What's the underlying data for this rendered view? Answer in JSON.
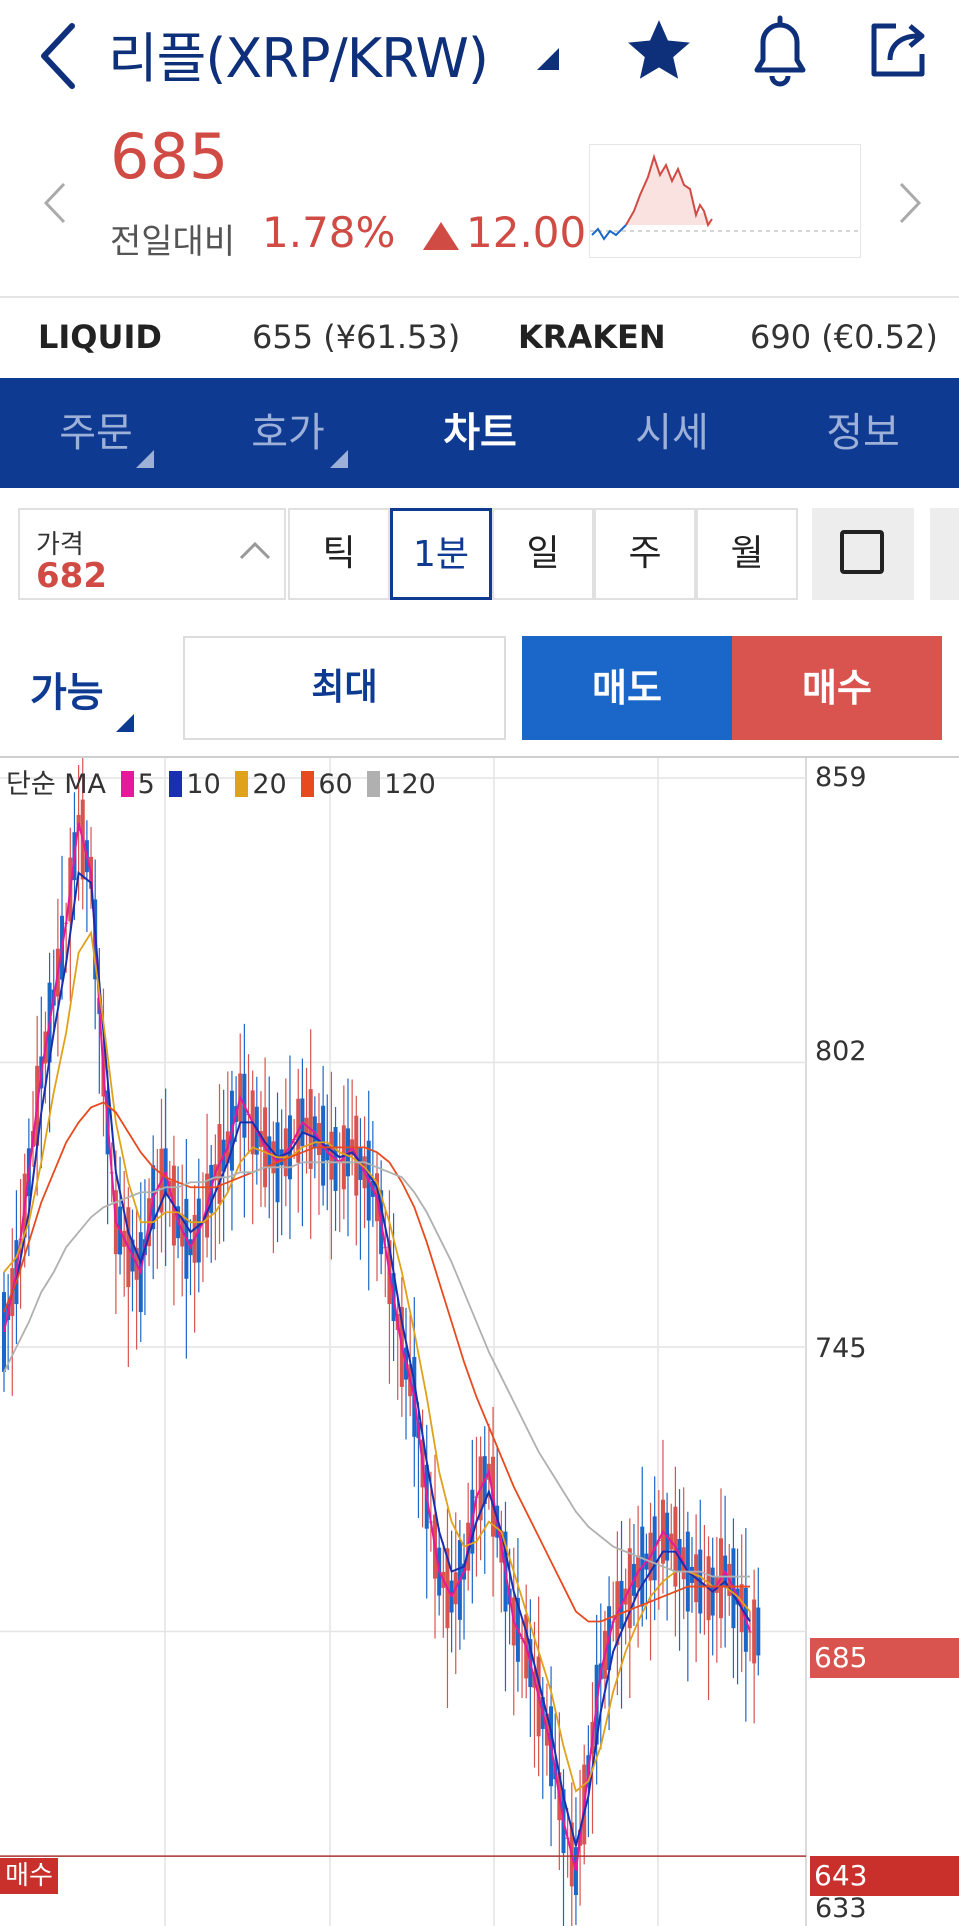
{
  "header": {
    "title": "리플(XRP/KRW)",
    "back_icon": "chevron-left-icon",
    "favorite_icon": "star-icon",
    "alert_icon": "bell-icon",
    "share_icon": "share-icon"
  },
  "summary": {
    "price": "685",
    "change_label": "전일대비",
    "change_pct": "1.78%",
    "change_amount": "12.00",
    "direction": "up",
    "color_up": "#d04b44"
  },
  "exchanges": [
    {
      "name": "LIQUID",
      "value": "655 (¥61.53)"
    },
    {
      "name": "KRAKEN",
      "value": "690 (€0.52)"
    }
  ],
  "tabs": [
    {
      "label": "주문",
      "active": false,
      "has_dropdown": true
    },
    {
      "label": "호가",
      "active": false,
      "has_dropdown": true
    },
    {
      "label": "차트",
      "active": true,
      "has_dropdown": false
    },
    {
      "label": "시세",
      "active": false,
      "has_dropdown": false
    },
    {
      "label": "정보",
      "active": false,
      "has_dropdown": false
    }
  ],
  "price_box": {
    "label": "가격",
    "value": "682"
  },
  "timeframes": [
    {
      "label": "틱",
      "active": false
    },
    {
      "label": "1분",
      "active": true
    },
    {
      "label": "일",
      "active": false
    },
    {
      "label": "주",
      "active": false
    },
    {
      "label": "월",
      "active": false
    }
  ],
  "actions": {
    "available_label": "가능",
    "max_label": "최대",
    "sell_label": "매도",
    "buy_label": "매수",
    "sell_color": "#1b67c9",
    "buy_color": "#d9534f"
  },
  "chart": {
    "legend_prefix": "단순 MA",
    "ma_series": [
      {
        "period": "5",
        "color": "#e5199a"
      },
      {
        "period": "10",
        "color": "#1a2fb0"
      },
      {
        "period": "20",
        "color": "#e0a21a"
      },
      {
        "period": "60",
        "color": "#e84a1f"
      },
      {
        "period": "120",
        "color": "#b0b0b0"
      }
    ],
    "y_labels": [
      "859",
      "802",
      "745"
    ],
    "y_min_label": "633",
    "current_price_tag": "685",
    "buy_line_label": "매수",
    "buy_price_tag": "643"
  },
  "chart_data": {
    "type": "line",
    "ylim": [
      633,
      859
    ],
    "y_ticks": [
      859,
      802,
      745
    ],
    "x": [
      0,
      1,
      2,
      3,
      4,
      5,
      6,
      7,
      8,
      9,
      10,
      11,
      12,
      13,
      14,
      15,
      16,
      17,
      18,
      19,
      20,
      21,
      22,
      23,
      24,
      25,
      26,
      27,
      28,
      29,
      30,
      31,
      32,
      33,
      34,
      35,
      36,
      37,
      38,
      39,
      40,
      41,
      42,
      43,
      44,
      45,
      46,
      47,
      48,
      49,
      50,
      51,
      52,
      53,
      54,
      55,
      56,
      57,
      58,
      59,
      60
    ],
    "series": [
      {
        "name": "5",
        "values": [
          748,
          760,
          780,
          800,
          815,
          830,
          850,
          840,
          800,
          770,
          765,
          760,
          775,
          780,
          770,
          765,
          770,
          780,
          785,
          795,
          790,
          785,
          782,
          785,
          790,
          788,
          784,
          782,
          785,
          780,
          775,
          760,
          745,
          735,
          715,
          700,
          695,
          700,
          715,
          720,
          705,
          690,
          685,
          675,
          665,
          650,
          640,
          660,
          680,
          690,
          695,
          700,
          703,
          708,
          705,
          700,
          698,
          696,
          700,
          695,
          688
        ]
      },
      {
        "name": "10",
        "values": [
          752,
          758,
          772,
          792,
          808,
          822,
          840,
          838,
          808,
          780,
          768,
          762,
          770,
          776,
          772,
          768,
          770,
          776,
          782,
          790,
          790,
          786,
          783,
          784,
          788,
          787,
          785,
          783,
          784,
          781,
          777,
          765,
          750,
          738,
          722,
          708,
          700,
          701,
          710,
          716,
          708,
          696,
          688,
          678,
          668,
          655,
          645,
          655,
          672,
          684,
          690,
          696,
          700,
          704,
          704,
          700,
          698,
          696,
          698,
          694,
          690
        ]
      },
      {
        "name": "20",
        "values": [
          760,
          763,
          770,
          782,
          796,
          808,
          824,
          828,
          810,
          790,
          778,
          770,
          770,
          772,
          772,
          770,
          770,
          772,
          776,
          782,
          785,
          784,
          783,
          783,
          785,
          786,
          786,
          784,
          783,
          781,
          778,
          770,
          760,
          748,
          735,
          720,
          710,
          705,
          706,
          710,
          708,
          700,
          692,
          684,
          676,
          665,
          656,
          658,
          665,
          676,
          684,
          690,
          695,
          698,
          700,
          700,
          699,
          697,
          697,
          695,
          692
        ]
      },
      {
        "name": "60",
        "values": [
          752,
          758,
          766,
          774,
          780,
          786,
          790,
          793,
          794,
          792,
          788,
          784,
          781,
          779,
          778,
          777,
          777,
          777,
          778,
          779,
          780,
          781,
          782,
          783,
          784,
          785,
          785,
          785,
          785,
          785,
          784,
          782,
          778,
          773,
          766,
          758,
          750,
          742,
          735,
          729,
          723,
          717,
          712,
          707,
          702,
          697,
          692,
          690,
          690,
          691,
          692,
          693,
          694,
          695,
          696,
          697,
          697,
          697,
          697,
          697,
          697
        ]
      },
      {
        "name": "120",
        "values": [
          740,
          745,
          750,
          756,
          760,
          765,
          768,
          771,
          773,
          774,
          775,
          776,
          776,
          777,
          777,
          778,
          778,
          779,
          779,
          780,
          780,
          781,
          781,
          781,
          782,
          782,
          782,
          782,
          782,
          782,
          781,
          780,
          779,
          776,
          772,
          767,
          762,
          756,
          750,
          744,
          739,
          734,
          729,
          724,
          720,
          716,
          712,
          709,
          707,
          705,
          704,
          703,
          702,
          701,
          700,
          700,
          700,
          699,
          699,
          699,
          699
        ]
      }
    ],
    "current_price": 685,
    "buy_line_price": 643
  }
}
